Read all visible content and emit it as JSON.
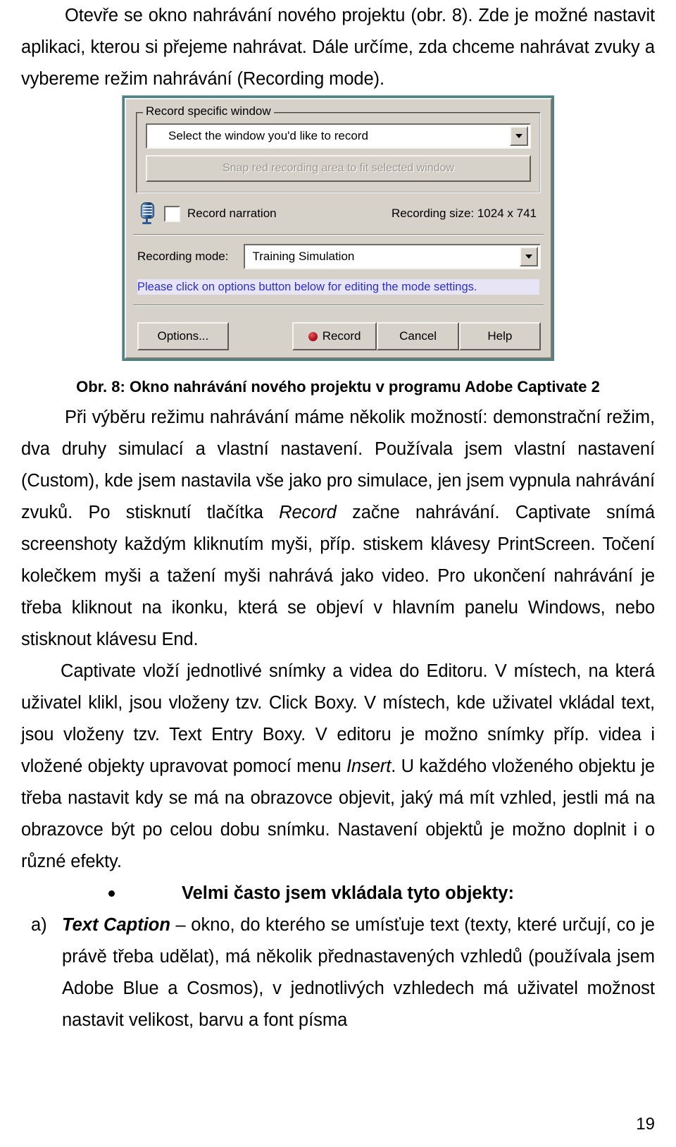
{
  "document": {
    "page_number": "19",
    "paragraphs": {
      "intro": "Otevře se okno nahrávání nového projektu (obr. 8). Zde je možné nastavit aplikaci, kterou si přejeme nahrávat. Dále určíme, zda chceme nahrávat zvuky a vybereme režim nahrávání (Recording mode).",
      "caption": "Obr.  8: Okno nahrávání nového projektu v programu Adobe Captivate 2",
      "p2_part1": "Při výběru režimu nahrávání máme několik možností: demonstrační režim, dva druhy simulací a vlastní nastavení. Používala jsem vlastní nastavení (Custom), kde jsem nastavila vše jako pro simulace, jen jsem vypnula nahrávání zvuků. Po stisknutí tlačítka ",
      "p2_italic1": "Record",
      "p2_part2": " začne nahrávání. Captivate snímá screenshoty každým kliknutím myši, příp. stiskem klávesy PrintScreen. Točení kolečkem myši a tažení myši nahrává jako video. Pro ukončení nahrávání je třeba kliknout na ikonku, která se objeví v hlavním panelu Windows, nebo stisknout klávesu End.",
      "p3_part1": "Captivate vloží jednotlivé snímky a videa do Editoru. V místech, na která uživatel klikl, jsou vloženy tzv. Click Boxy. V místech, kde uživatel vkládal text, jsou vloženy tzv. Text Entry Boxy. V editoru je možno snímky příp. videa i vložené objekty upravovat pomocí menu ",
      "p3_italic1": "Insert",
      "p3_part2": ". U každého vloženého objektu je třeba nastavit kdy se má na obrazovce objevit, jaký má mít vzhled, jestli má na obrazovce být po celou dobu snímku. Nastavení objektů je možno doplnit i o různé efekty.",
      "bullet_heading": "Velmi často jsem vkládala tyto objekty:",
      "list_a_marker": "a)",
      "list_a_bold": "Text Caption",
      "list_a_text": " – okno, do kterého se umísťuje text (texty, které určují, co je právě třeba udělat), má několik přednastavených vzhledů (používala jsem Adobe Blue a Cosmos), v jednotlivých vzhledech má uživatel možnost nastavit velikost, barvu a font písma"
    }
  },
  "dialog": {
    "groupbox_title": "Record specific window",
    "window_combo_value": "Select the window you'd like to record",
    "snap_button_label": "Snap red recording area to fit selected window",
    "narration_checkbox_label": "Record narration",
    "recording_size_label": "Recording size: 1024 x 741",
    "recording_mode_label": "Recording mode:",
    "recording_mode_value": "Training Simulation",
    "hint_text": "Please click on options button below for editing the mode settings.",
    "buttons": {
      "options": "Options...",
      "record": "Record",
      "cancel": "Cancel",
      "help": "Help"
    },
    "colors": {
      "frame": "#4f8182",
      "face": "#d4d0c8",
      "hint": "#3030c8",
      "record_dot": "#b01020",
      "mic": "#2d5d96"
    }
  }
}
